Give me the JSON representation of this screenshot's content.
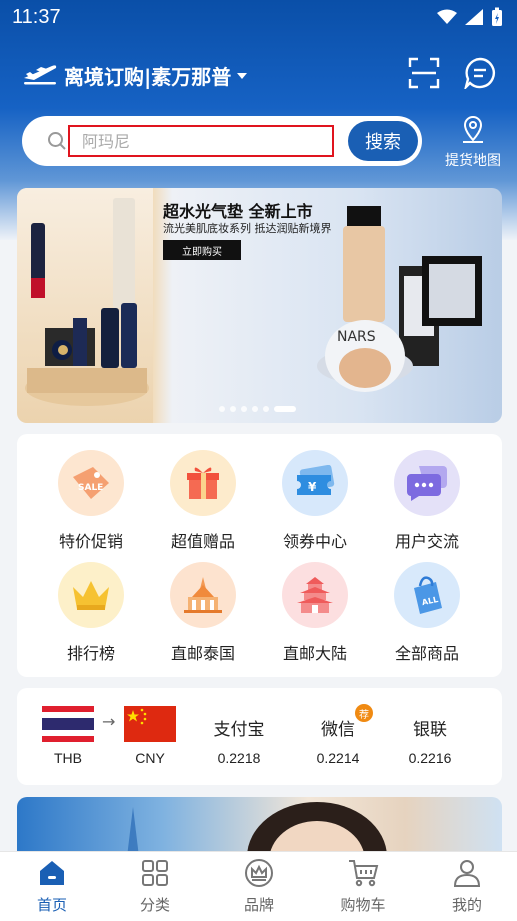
{
  "status_bar": {
    "time": "11:37"
  },
  "header": {
    "title": "离境订购|素万那普"
  },
  "search": {
    "placeholder": "阿玛尼",
    "button_label": "搜索"
  },
  "pickup_map": {
    "label": "提货地图"
  },
  "banner": {
    "title": "超水光气垫 全新上市",
    "subtitle": "流光美肌底妆系列 抵达润贴新境界",
    "button_label": "立即购买",
    "brand_text": "NARS",
    "dot_count": 6,
    "active_dot": 5
  },
  "categories": [
    {
      "label": "特价促销",
      "icon": "sale-tag-icon"
    },
    {
      "label": "超值赠品",
      "icon": "gift-box-icon"
    },
    {
      "label": "领券中心",
      "icon": "coupon-icon"
    },
    {
      "label": "用户交流",
      "icon": "chat-bubble-icon"
    },
    {
      "label": "排行榜",
      "icon": "crown-icon"
    },
    {
      "label": "直邮泰国",
      "icon": "thai-temple-icon"
    },
    {
      "label": "直邮大陆",
      "icon": "pagoda-icon"
    },
    {
      "label": "全部商品",
      "icon": "shopping-bag-icon"
    }
  ],
  "exchange": {
    "from_code": "THB",
    "arrow": "→",
    "to_code": "CNY",
    "rates": [
      {
        "name": "支付宝",
        "rate": "0.2218"
      },
      {
        "name": "微信",
        "rate": "0.2214",
        "badge": "荐"
      },
      {
        "name": "银联",
        "rate": "0.2216"
      }
    ]
  },
  "bottom_nav": [
    {
      "label": "首页",
      "icon": "home-icon",
      "active": true
    },
    {
      "label": "分类",
      "icon": "grid-icon",
      "active": false
    },
    {
      "label": "品牌",
      "icon": "crown-badge-icon",
      "active": false
    },
    {
      "label": "购物车",
      "icon": "cart-icon",
      "active": false
    },
    {
      "label": "我的",
      "icon": "user-icon",
      "active": false
    }
  ],
  "colors": {
    "primary": "#1a5fb4",
    "search_highlight": "#e0141e",
    "badge": "#f08a12"
  }
}
